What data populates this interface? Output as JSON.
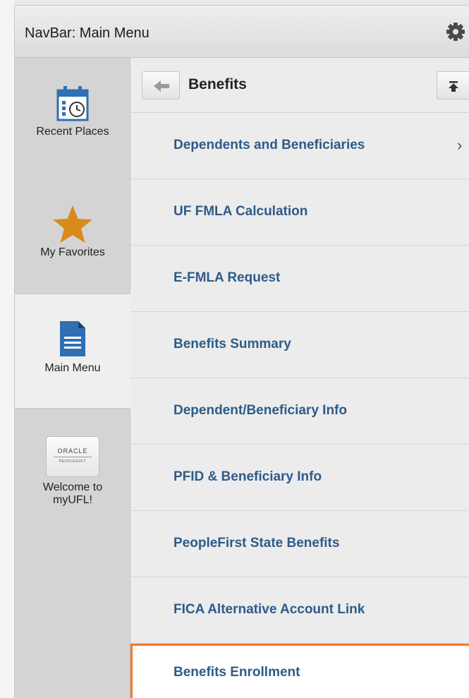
{
  "header": {
    "title": "NavBar: Main Menu",
    "settings_icon": "gear-icon"
  },
  "sidebar": {
    "items": [
      {
        "label": "Recent Places",
        "icon": "calendar-clock-icon"
      },
      {
        "label": "My Favorites",
        "icon": "star-icon",
        "icon_color": "#d98a1a"
      },
      {
        "label": "Main Menu",
        "icon": "document-icon",
        "icon_color": "#2f6fb3",
        "active": true
      },
      {
        "label_line1": "Welcome to",
        "label_line2": "myUFL!",
        "icon": "oracle-peoplesoft-logo",
        "logo_line1": "ORACLE",
        "logo_line2": "PEOPLESOFT"
      }
    ]
  },
  "breadcrumb": {
    "title": "Benefits",
    "back_icon": "back-arrow-icon",
    "top_icon": "scroll-to-top-icon"
  },
  "menu": {
    "items": [
      {
        "label": "Dependents and Beneficiaries",
        "has_submenu": true,
        "chevron": "›"
      },
      {
        "label": "UF FMLA Calculation"
      },
      {
        "label": "E-FMLA Request"
      },
      {
        "label": "Benefits Summary"
      },
      {
        "label": "Dependent/Beneficiary Info"
      },
      {
        "label": "PFID & Beneficiary Info"
      },
      {
        "label": "PeopleFirst State Benefits"
      },
      {
        "label": "FICA Alternative Account Link"
      },
      {
        "label": "Benefits Enrollment",
        "highlighted": true
      }
    ]
  },
  "colors": {
    "link": "#2e5b8a",
    "highlight_border": "#f07b2c",
    "star": "#d98a1a",
    "doc": "#2f6fb3"
  }
}
